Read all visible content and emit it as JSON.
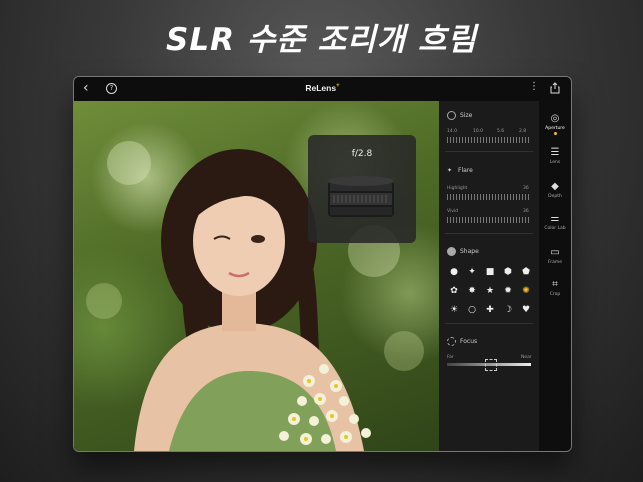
{
  "headline": "SLR 수준 조리개 흐림",
  "app": {
    "logo": "ReLens",
    "logo_mark": "+"
  },
  "lens_popup": {
    "aperture": "f/2.8"
  },
  "panel": {
    "size": {
      "title": "Size",
      "scale_labels": [
        "14.0",
        "10.0",
        "5.6",
        "2.8"
      ]
    },
    "flare": {
      "title": "Flare",
      "highlight_label": "Highlight",
      "highlight_value": "36",
      "vivid_label": "Vivid",
      "vivid_value": "36"
    },
    "shape": {
      "title": "Shape",
      "shapes": [
        "●",
        "✦",
        "■",
        "⬢",
        "⬟",
        "✿",
        "✸",
        "★",
        "✹",
        "✺",
        "☀",
        "☽",
        "✚",
        "⬮",
        "♥",
        "●",
        "○",
        "⬭"
      ]
    },
    "focus": {
      "title": "Focus",
      "near_label": "Far",
      "far_label": "Near"
    }
  },
  "rail": [
    {
      "label": "Aperture",
      "icon": "aperture-icon",
      "active": true
    },
    {
      "label": "Lens",
      "icon": "lens-icon",
      "active": false
    },
    {
      "label": "Depth",
      "icon": "layers-icon",
      "active": false
    },
    {
      "label": "Color Lab",
      "icon": "sliders-icon",
      "active": false
    },
    {
      "label": "Frame",
      "icon": "frame-icon",
      "active": false
    },
    {
      "label": "Crop",
      "icon": "crop-icon",
      "active": false
    }
  ],
  "colors": {
    "accent": "#f2b928",
    "panel_bg": "#1b1b1b",
    "rail_bg": "#0e0e0e"
  }
}
